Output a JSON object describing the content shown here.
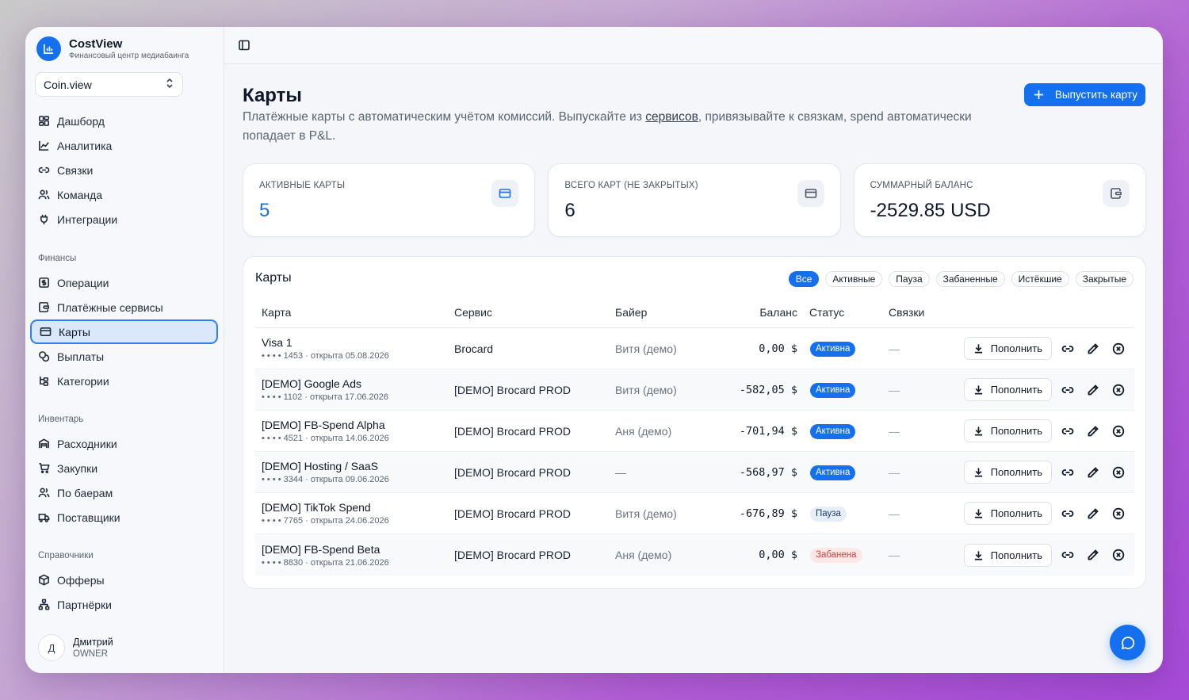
{
  "app": {
    "name": "CostView",
    "subtitle": "Финансовый центр медиабаинга",
    "workspace": "Coin.view"
  },
  "sidebar": {
    "main": [
      {
        "label": "Дашборд",
        "icon": "dashboard-icon"
      },
      {
        "label": "Аналитика",
        "icon": "chart-line-icon"
      },
      {
        "label": "Связки",
        "icon": "link-icon"
      },
      {
        "label": "Команда",
        "icon": "users-icon"
      },
      {
        "label": "Интеграции",
        "icon": "plug-icon"
      }
    ],
    "finance_header": "Финансы",
    "finance": [
      {
        "label": "Операции",
        "icon": "dollar-square-icon"
      },
      {
        "label": "Платёжные сервисы",
        "icon": "wallet-icon"
      },
      {
        "label": "Карты",
        "icon": "credit-card-icon",
        "active": true
      },
      {
        "label": "Выплаты",
        "icon": "coins-icon"
      },
      {
        "label": "Категории",
        "icon": "tree-icon"
      }
    ],
    "inventory_header": "Инвентарь",
    "inventory": [
      {
        "label": "Расходники",
        "icon": "warehouse-icon"
      },
      {
        "label": "Закупки",
        "icon": "cart-icon"
      },
      {
        "label": "По баерам",
        "icon": "users-icon"
      },
      {
        "label": "Поставщики",
        "icon": "truck-icon"
      }
    ],
    "refs_header": "Справочники",
    "refs": [
      {
        "label": "Офферы",
        "icon": "box-icon"
      },
      {
        "label": "Партнёрки",
        "icon": "network-icon"
      }
    ],
    "user": {
      "initial": "Д",
      "name": "Дмитрий",
      "role": "OWNER"
    }
  },
  "page": {
    "title": "Карты",
    "desc_before": "Платёжные карты с автоматическим учётом комиссий. Выпускайте из ",
    "desc_link": "сервисов",
    "desc_after": ", привязывайте к связкам, spend автоматически попадает в P&L.",
    "issue_button": "Выпустить карту"
  },
  "stats": [
    {
      "label": "АКТИВНЫЕ КАРТЫ",
      "value": "5",
      "icon": "credit-card-icon"
    },
    {
      "label": "ВСЕГО КАРТ (НЕ ЗАКРЫТЫХ)",
      "value": "6",
      "icon": "credit-card-icon"
    },
    {
      "label": "СУММАРНЫЙ БАЛАНС",
      "value": "-2529.85 USD",
      "icon": "wallet-icon"
    }
  ],
  "cards_panel": {
    "title": "Карты",
    "filters": [
      "Все",
      "Активные",
      "Пауза",
      "Забаненные",
      "Истёкшие",
      "Закрытые"
    ],
    "active_filter": "Все",
    "columns": [
      "Карта",
      "Сервис",
      "Байер",
      "Баланс",
      "Статус",
      "Связки"
    ],
    "topup_label": "Пополнить",
    "rows": [
      {
        "name": "Visa 1",
        "sub": "• • • • 1453 · открыта 05.08.2026",
        "service": "Brocard",
        "buyer": "Витя (демо)",
        "balance": "0,00 $",
        "status": "Активна",
        "status_kind": "active",
        "links": "—"
      },
      {
        "name": "[DEMO] Google Ads",
        "sub": "• • • • 1102 · открыта 17.06.2026",
        "service": "[DEMO] Brocard PROD",
        "buyer": "Витя (демо)",
        "balance": "-582,05 $",
        "status": "Активна",
        "status_kind": "active",
        "links": "—"
      },
      {
        "name": "[DEMO] FB-Spend Alpha",
        "sub": "• • • • 4521 · открыта 14.06.2026",
        "service": "[DEMO] Brocard PROD",
        "buyer": "Аня (демо)",
        "balance": "-701,94 $",
        "status": "Активна",
        "status_kind": "active",
        "links": "—"
      },
      {
        "name": "[DEMO] Hosting / SaaS",
        "sub": "• • • • 3344 · открыта 09.06.2026",
        "service": "[DEMO] Brocard PROD",
        "buyer": "—",
        "balance": "-568,97 $",
        "status": "Активна",
        "status_kind": "active",
        "links": "—"
      },
      {
        "name": "[DEMO] TikTok Spend",
        "sub": "• • • • 7765 · открыта 24.06.2026",
        "service": "[DEMO] Brocard PROD",
        "buyer": "Витя (демо)",
        "balance": "-676,89 $",
        "status": "Пауза",
        "status_kind": "pause",
        "links": "—"
      },
      {
        "name": "[DEMO] FB-Spend Beta",
        "sub": "• • • • 8830 · открыта 21.06.2026",
        "service": "[DEMO] Brocard PROD",
        "buyer": "Аня (демо)",
        "balance": "0,00 $",
        "status": "Забанена",
        "status_kind": "ban",
        "links": "—"
      }
    ]
  },
  "colors": {
    "accent": "#1570ef",
    "active_badge": "#1570ef",
    "ban_badge_text": "#d63b3b"
  }
}
